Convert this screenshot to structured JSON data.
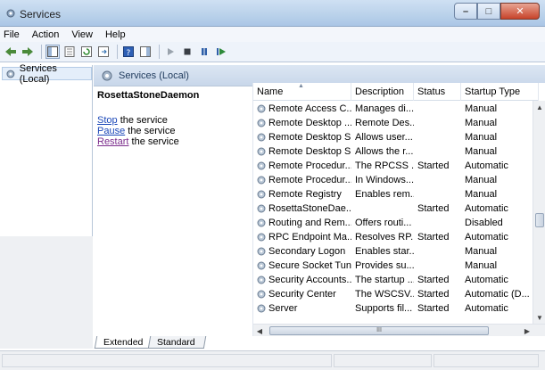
{
  "window": {
    "title": "Services",
    "icon": "gear-icon"
  },
  "menu": [
    "File",
    "Action",
    "View",
    "Help"
  ],
  "tree": {
    "item_label": "Services (Local)"
  },
  "pane_header": {
    "label": "Services (Local)"
  },
  "description": {
    "service_name": "RosettaStoneDaemon",
    "actions": [
      {
        "link": "Stop",
        "rest": " the service"
      },
      {
        "link": "Pause",
        "rest": " the service"
      },
      {
        "link": "Restart",
        "rest": " the service"
      }
    ]
  },
  "columns": [
    "Name",
    "Description",
    "Status",
    "Startup Type"
  ],
  "services": [
    {
      "name": "Remote Access C...",
      "desc": "Manages di...",
      "status": "",
      "startup": "Manual"
    },
    {
      "name": "Remote Desktop ...",
      "desc": "Remote Des...",
      "status": "",
      "startup": "Manual"
    },
    {
      "name": "Remote Desktop S...",
      "desc": "Allows user...",
      "status": "",
      "startup": "Manual"
    },
    {
      "name": "Remote Desktop S...",
      "desc": "Allows the r...",
      "status": "",
      "startup": "Manual"
    },
    {
      "name": "Remote Procedur...",
      "desc": "The RPCSS ...",
      "status": "Started",
      "startup": "Automatic"
    },
    {
      "name": "Remote Procedur...",
      "desc": "In Windows...",
      "status": "",
      "startup": "Manual"
    },
    {
      "name": "Remote Registry",
      "desc": "Enables rem...",
      "status": "",
      "startup": "Manual"
    },
    {
      "name": "RosettaStoneDae...",
      "desc": "",
      "status": "Started",
      "startup": "Automatic"
    },
    {
      "name": "Routing and Rem...",
      "desc": "Offers routi...",
      "status": "",
      "startup": "Disabled"
    },
    {
      "name": "RPC Endpoint Ma...",
      "desc": "Resolves RP...",
      "status": "Started",
      "startup": "Automatic"
    },
    {
      "name": "Secondary Logon",
      "desc": "Enables star...",
      "status": "",
      "startup": "Manual"
    },
    {
      "name": "Secure Socket Tun...",
      "desc": "Provides su...",
      "status": "",
      "startup": "Manual"
    },
    {
      "name": "Security Accounts...",
      "desc": "The startup ...",
      "status": "Started",
      "startup": "Automatic"
    },
    {
      "name": "Security Center",
      "desc": "The WSCSV...",
      "status": "Started",
      "startup": "Automatic (D..."
    },
    {
      "name": "Server",
      "desc": "Supports fil...",
      "status": "Started",
      "startup": "Automatic"
    }
  ],
  "tabs": {
    "extended": "Extended",
    "standard": "Standard"
  },
  "hscroll_grip": "III"
}
